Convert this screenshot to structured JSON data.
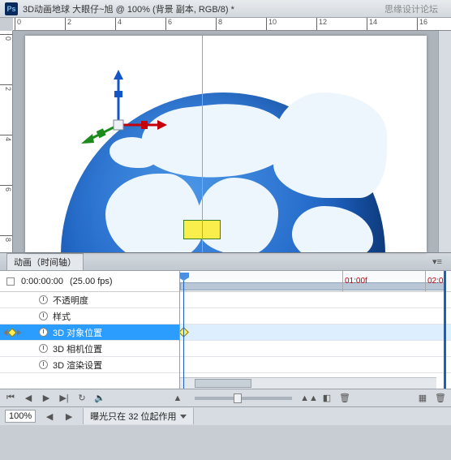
{
  "titlebar": {
    "app_icon_text": "Ps",
    "document_title": "3D动画地球   大眼仔~旭 @ 100% (背景 副本, RGB/8) *",
    "watermark": "思缘设计论坛"
  },
  "ruler_h": [
    "0",
    "2",
    "4",
    "6",
    "8",
    "10",
    "12",
    "14",
    "16"
  ],
  "ruler_v": [
    "0",
    "2",
    "4",
    "6",
    "8"
  ],
  "animation_panel": {
    "tab_label": "动画（时间轴）",
    "current_time": "0:00:00:00",
    "fps_label": "(25.00 fps)",
    "tracks": [
      {
        "label": "不透明度",
        "selected": false
      },
      {
        "label": "样式",
        "selected": false
      },
      {
        "label": "3D 对象位置",
        "selected": true
      },
      {
        "label": "3D 相机位置",
        "selected": false
      },
      {
        "label": "3D 渲染设置",
        "selected": false
      }
    ],
    "time_marks": [
      {
        "label": "01:00f",
        "pos": 200
      },
      {
        "label": "02:0",
        "pos": 302
      }
    ]
  },
  "status": {
    "zoom": "100%",
    "info": "曝光只在 32 位起作用"
  }
}
